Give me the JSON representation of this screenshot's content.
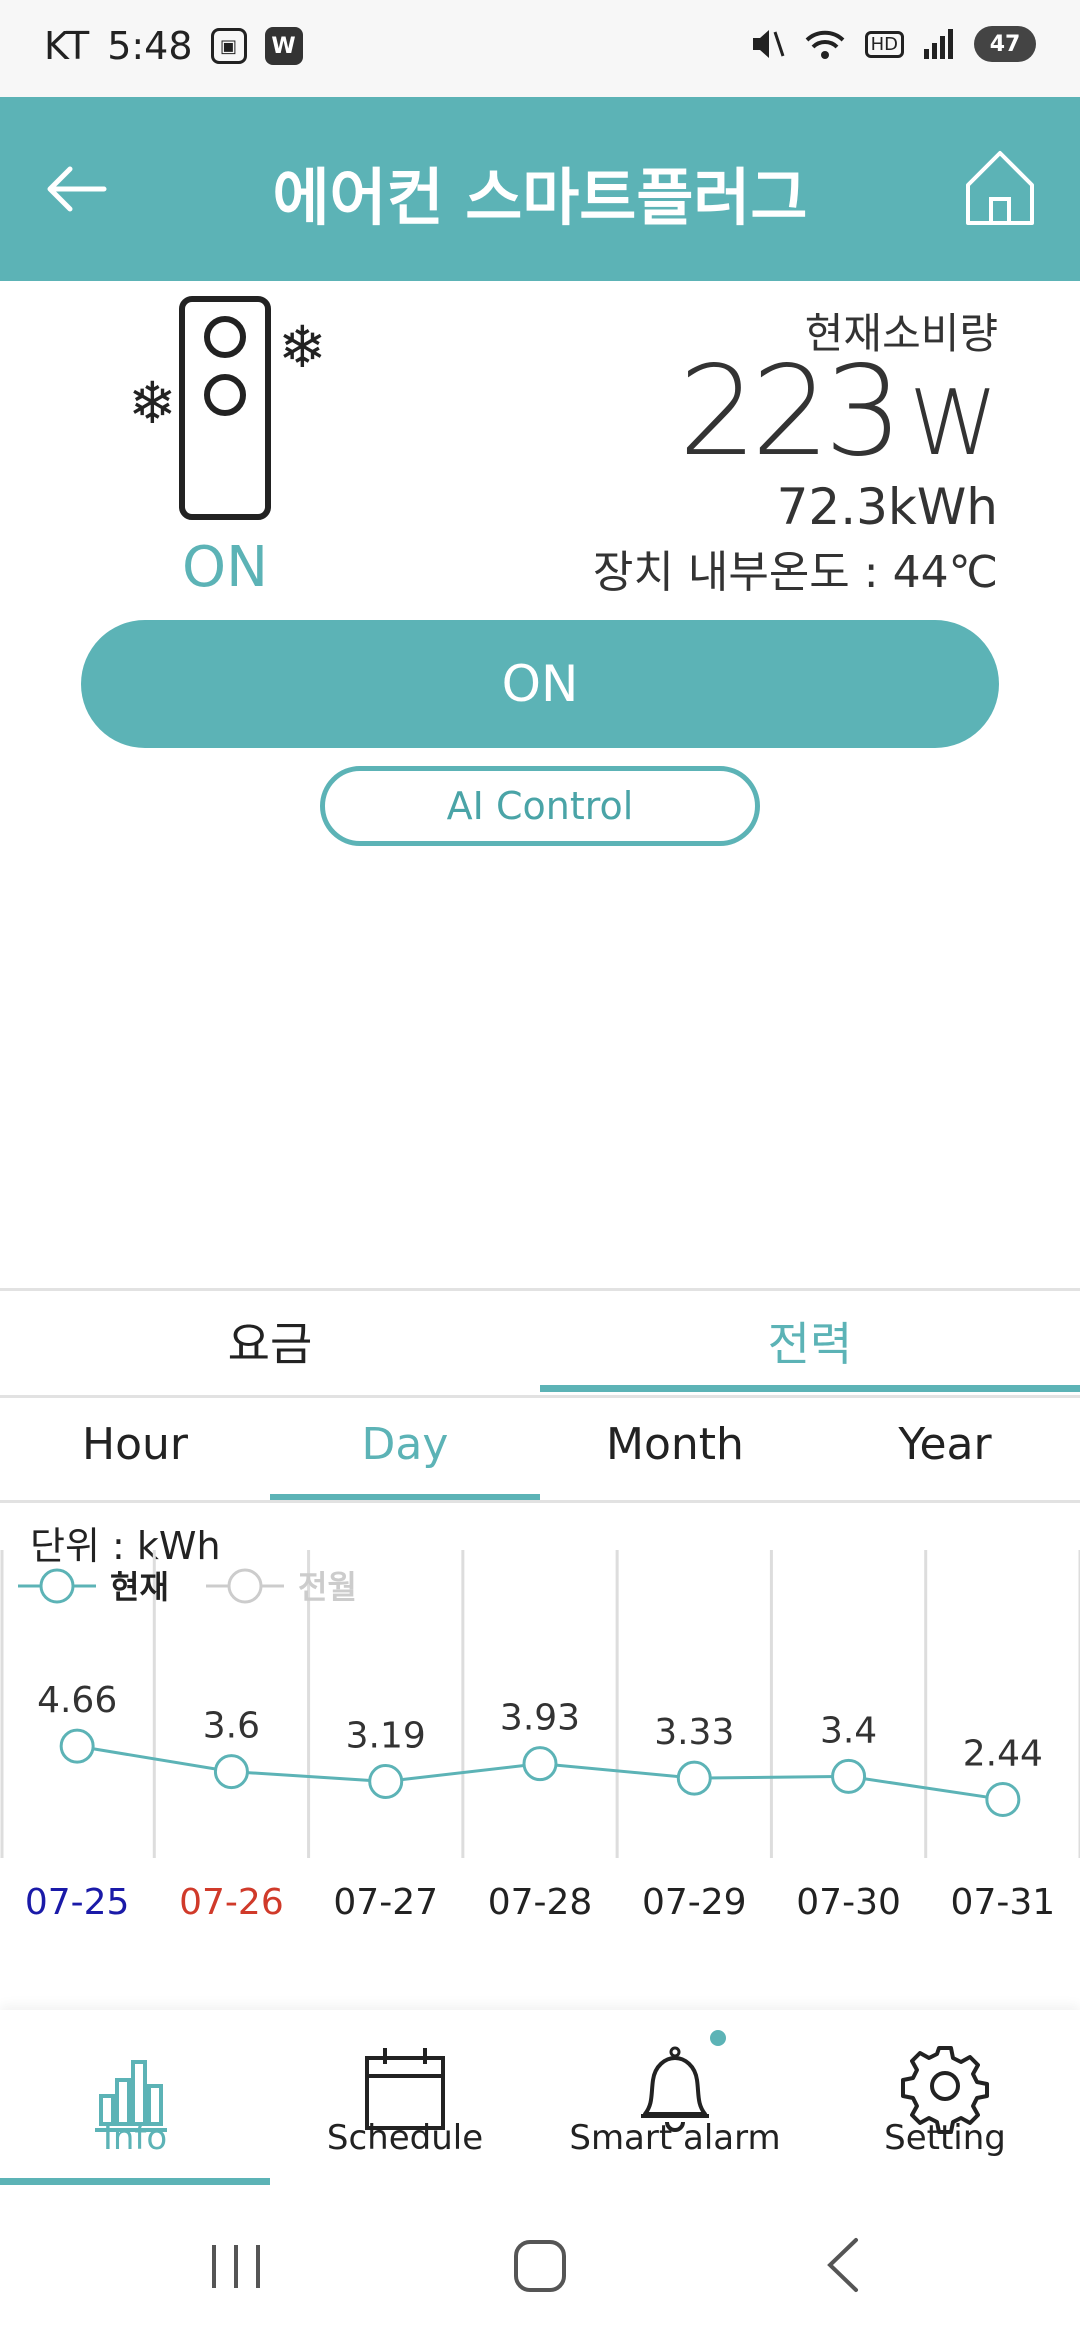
{
  "status_bar": {
    "carrier": "KT",
    "time": "5:48",
    "app_badge": "W",
    "battery": "47",
    "hd": "HD"
  },
  "header": {
    "title": "에어컨 스마트플러그"
  },
  "device": {
    "state": "ON",
    "consumption_label": "현재소비량",
    "power_value": "223",
    "power_unit": "W",
    "energy_total": "72.3kWh",
    "internal_temp": "장치 내부온도 : 44℃"
  },
  "buttons": {
    "on_label": "ON",
    "ai_label": "AI Control"
  },
  "tabs": {
    "fee": "요금",
    "power": "전력"
  },
  "subtabs": {
    "hour": "Hour",
    "day": "Day",
    "month": "Month",
    "year": "Year"
  },
  "unit_label": "단위 : kWh",
  "chart_data": {
    "type": "line",
    "legend": [
      {
        "name": "현재",
        "active": true
      },
      {
        "name": "전월",
        "active": false
      }
    ],
    "categories": [
      "07-25",
      "07-26",
      "07-27",
      "07-28",
      "07-29",
      "07-30",
      "07-31"
    ],
    "category_colors": [
      "#1a1aa8",
      "#d03a2a",
      "#222222",
      "#222222",
      "#222222",
      "#222222",
      "#222222"
    ],
    "series": [
      {
        "name": "현재",
        "values": [
          4.66,
          3.6,
          3.19,
          3.93,
          3.33,
          3.4,
          2.44
        ],
        "color": "#5cb3b6"
      }
    ],
    "ylim": [
      0,
      12
    ],
    "grid": "vertical"
  },
  "bottom_nav": {
    "info": "Info",
    "schedule": "Schedule",
    "alarm": "Smart alarm",
    "setting": "Setting"
  },
  "colors": {
    "accent": "#5cb3b6"
  }
}
